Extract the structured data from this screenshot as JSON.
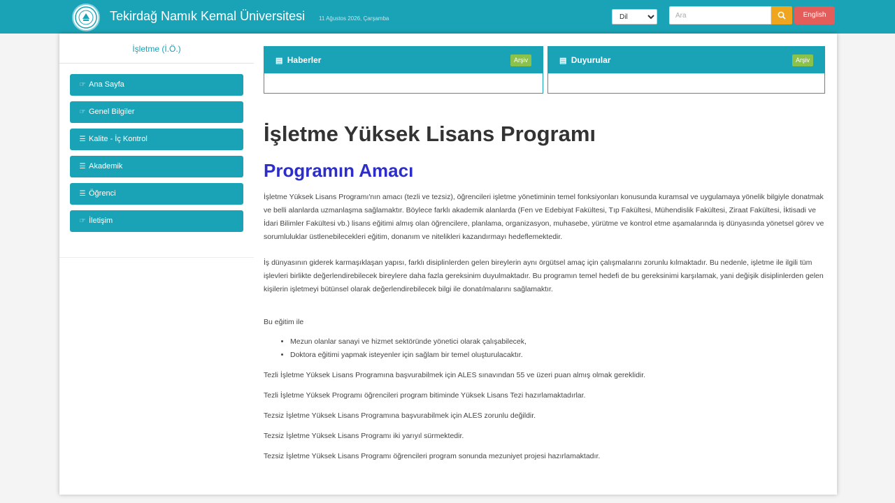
{
  "header": {
    "site_title": "Tekirdağ Namık Kemal Üniversitesi",
    "date_text": "11 Ağustos 2026, Çarşamba",
    "lang_select": "Dil",
    "search_placeholder": "Ara",
    "english_label": "English"
  },
  "sidebar": {
    "title": "İşletme (İ.Ö.)",
    "items": [
      {
        "icon": "hand-point-right-icon",
        "glyph": "☞",
        "label": "Ana Sayfa"
      },
      {
        "icon": "hand-point-right-icon",
        "glyph": "☞",
        "label": "Genel Bilgiler"
      },
      {
        "icon": "menu-icon",
        "glyph": "☰",
        "label": "Kalite - İç Kontrol"
      },
      {
        "icon": "menu-icon",
        "glyph": "☰",
        "label": "Akademik"
      },
      {
        "icon": "menu-icon",
        "glyph": "☰",
        "label": "Öğrenci"
      },
      {
        "icon": "hand-point-right-icon",
        "glyph": "☞",
        "label": "İletişim"
      }
    ]
  },
  "panels": [
    {
      "title": "Haberler",
      "badge": "Arşiv",
      "icon": "list-icon"
    },
    {
      "title": "Duyurular",
      "badge": "Arşiv",
      "icon": "list-icon"
    }
  ],
  "content": {
    "page_title": "İşletme Yüksek Lisans Programı",
    "section_title": "Programın Amacı",
    "paragraph1": "İşletme Yüksek Lisans Programı'nın amacı (tezli ve tezsiz), öğrencileri işletme yönetiminin temel fonksiyonları konusunda kuramsal ve uygulamaya yönelik bilgiyle donatmak ve belli alanlarda uzmanlaşma sağlamaktır. Böylece farklı akademik alanlarda (Fen ve Edebiyat Fakültesi, Tıp Fakültesi, Mühendislik Fakültesi, Ziraat Fakültesi, İktisadi ve İdari Bilimler Fakültesi vb.) lisans eğitimi almış olan öğrencilere, planlama, organizasyon, muhasebe, yürütme ve kontrol etme aşamalarında iş dünyasında yönetsel görev ve sorumluluklar üstlenebilecekleri eğitim, donanım ve nitelikleri kazandırmayı hedeflemektedir.",
    "paragraph2": "İş dünyasının giderek karmaşıklaşan yapısı, farklı disiplinlerden gelen bireylerin aynı örgütsel amaç için çalışmalarını zorunlu kılmaktadır. Bu nedenle, işletme ile ilgili tüm işlevleri birlikte değerlendirebilecek bireylere daha fazla gereksinim duyulmaktadır. Bu programın temel hedefi de bu gereksinimi karşılamak, yani değişik disiplinlerden gelen kişilerin işletmeyi bütünsel olarak değerlendirebilecek bilgi ile donatılmalarını sağlamaktır.",
    "intro": "Bu eğitim ile",
    "bullets": [
      "Mezun olanlar sanayi ve hizmet sektöründe yönetici olarak çalışabilecek,",
      "Doktora eğitimi yapmak isteyenler için sağlam bir temel oluşturulacaktır."
    ],
    "line1": "Tezli İşletme Yüksek Lisans Programına başvurabilmek için ALES sınavından 55 ve üzeri puan almış olmak gereklidir.",
    "line2": "Tezli İşletme Yüksek Programı öğrencileri program bitiminde Yüksek Lisans Tezi hazırlamaktadırlar.",
    "line3": "Tezsiz İşletme Yüksek Lisans Programına başvurabilmek için ALES zorunlu değildir.",
    "line4": "Tezsiz İşletme Yüksek Lisans Programı iki yarıyıl sürmektedir.",
    "line5": " Tezsiz İşletme Yüksek Lisans Programı öğrencileri program sonunda mezuniyet projesi hazırlamaktadır."
  },
  "colors": {
    "primary": "#1aa3b6",
    "section_title": "#2d2ec9",
    "search_button": "#f0a51e",
    "english_button": "#e35d5b",
    "badge": "#8bc34a"
  }
}
